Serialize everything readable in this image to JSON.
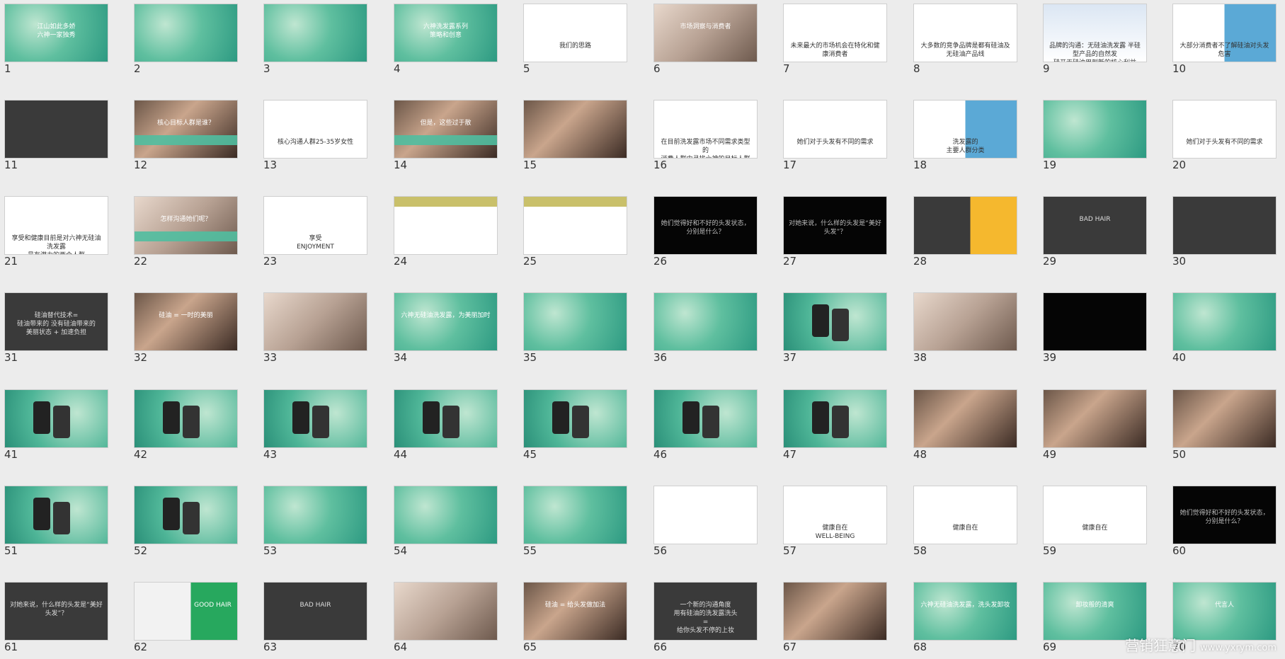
{
  "slides": [
    {
      "n": "1",
      "style": "t-green",
      "title": "江山如此多娇\n六神一家独秀"
    },
    {
      "n": "2",
      "style": "t-green",
      "title": ""
    },
    {
      "n": "3",
      "style": "t-green",
      "title": ""
    },
    {
      "n": "4",
      "style": "t-green",
      "title": "六神洗发露系列\n策略和创意"
    },
    {
      "n": "5",
      "style": "t-white",
      "title": "我们的思路"
    },
    {
      "n": "6",
      "style": "t-photo-light",
      "title": "市场洞察与消费者"
    },
    {
      "n": "7",
      "style": "t-white",
      "title": "未来最大的市场机会在特化和健康消费者"
    },
    {
      "n": "8",
      "style": "t-white",
      "title": "大多数的竞争品牌是都有硅油及无硅油产品线"
    },
    {
      "n": "9",
      "style": "t-blue",
      "title": "品牌的沟通：无硅油洗发露 半硅型产品的自然发\n硅开无硅油用到新的核心利益"
    },
    {
      "n": "10",
      "style": "t-mixed",
      "title": "大部分消费者不了解硅油对头发危害"
    },
    {
      "n": "11",
      "style": "t-dark",
      "title": ""
    },
    {
      "n": "12",
      "style": "t-photo t-bottom-band",
      "title": "核心目标人群是谁？"
    },
    {
      "n": "13",
      "style": "t-white",
      "title": "核心沟通人群25-35岁女性"
    },
    {
      "n": "14",
      "style": "t-photo t-bottom-band",
      "title": "但是，这些过于散"
    },
    {
      "n": "15",
      "style": "t-photo",
      "title": ""
    },
    {
      "n": "16",
      "style": "t-white",
      "title": "在目前洗发露市场不同需求类型的\n消费人群中寻找六神的目标人群"
    },
    {
      "n": "17",
      "style": "t-white",
      "title": "她们对于头发有不同的需求"
    },
    {
      "n": "18",
      "style": "t-mixed",
      "title": "洗发露的\n主要人群分类"
    },
    {
      "n": "19",
      "style": "t-green",
      "title": ""
    },
    {
      "n": "20",
      "style": "t-white",
      "title": "她们对于头发有不同的需求"
    },
    {
      "n": "21",
      "style": "t-white",
      "title": "享受和健康目前是对六神无硅油洗发露\n最有潜力的两个人群"
    },
    {
      "n": "22",
      "style": "t-photo-light t-bottom-band",
      "title": "怎样沟通她们呢？"
    },
    {
      "n": "23",
      "style": "t-white",
      "title": "享受\nENJOYMENT"
    },
    {
      "n": "24",
      "style": "t-yellowband",
      "title": ""
    },
    {
      "n": "25",
      "style": "t-yellowband",
      "title": ""
    },
    {
      "n": "26",
      "style": "t-black",
      "title": "她们觉得好和不好的头发状态，\n分别是什么？"
    },
    {
      "n": "27",
      "style": "t-black",
      "title": "对她来说，什么样的头发是“美好头发”？"
    },
    {
      "n": "28",
      "style": "accent-yellow",
      "title": ""
    },
    {
      "n": "29",
      "style": "t-dark",
      "title": "BAD HAIR"
    },
    {
      "n": "30",
      "style": "t-dark",
      "title": ""
    },
    {
      "n": "31",
      "style": "t-dark",
      "title": "硅油替代技术=\n硅油带来的    没有硅油带来的\n美丽状态   +   加速负担"
    },
    {
      "n": "32",
      "style": "t-photo",
      "title": "硅油 = 一时的美丽"
    },
    {
      "n": "33",
      "style": "t-photo-light",
      "title": ""
    },
    {
      "n": "34",
      "style": "t-green",
      "title": "六神无硅油洗发露，为美丽加时"
    },
    {
      "n": "35",
      "style": "t-green",
      "title": ""
    },
    {
      "n": "36",
      "style": "t-green",
      "title": ""
    },
    {
      "n": "37",
      "style": "t-phone",
      "title": ""
    },
    {
      "n": "38",
      "style": "t-photo-light",
      "title": ""
    },
    {
      "n": "39",
      "style": "t-black",
      "title": ""
    },
    {
      "n": "40",
      "style": "t-green",
      "title": ""
    },
    {
      "n": "41",
      "style": "t-phone",
      "title": ""
    },
    {
      "n": "42",
      "style": "t-phone",
      "title": ""
    },
    {
      "n": "43",
      "style": "t-phone",
      "title": ""
    },
    {
      "n": "44",
      "style": "t-phone",
      "title": ""
    },
    {
      "n": "45",
      "style": "t-phone",
      "title": ""
    },
    {
      "n": "46",
      "style": "t-phone",
      "title": ""
    },
    {
      "n": "47",
      "style": "t-phone",
      "title": ""
    },
    {
      "n": "48",
      "style": "t-photo",
      "title": ""
    },
    {
      "n": "49",
      "style": "t-photo",
      "title": ""
    },
    {
      "n": "50",
      "style": "t-photo",
      "title": ""
    },
    {
      "n": "51",
      "style": "t-phone",
      "title": ""
    },
    {
      "n": "52",
      "style": "t-phone",
      "title": ""
    },
    {
      "n": "53",
      "style": "t-green",
      "title": ""
    },
    {
      "n": "54",
      "style": "t-green",
      "title": ""
    },
    {
      "n": "55",
      "style": "t-green",
      "title": ""
    },
    {
      "n": "56",
      "style": "t-white",
      "title": ""
    },
    {
      "n": "57",
      "style": "t-white",
      "title": "健康自在\nWELL-BEING"
    },
    {
      "n": "58",
      "style": "t-white",
      "title": "健康自在"
    },
    {
      "n": "59",
      "style": "t-white",
      "title": "健康自在"
    },
    {
      "n": "60",
      "style": "t-black",
      "title": "她们觉得好和不好的头发状态，\n分别是什么？"
    },
    {
      "n": "61",
      "style": "t-dark",
      "title": "对她来说，什么样的头发是“美好头发”？"
    },
    {
      "n": "62",
      "style": "green-right",
      "title": "GOOD HAIR"
    },
    {
      "n": "63",
      "style": "t-dark",
      "title": "BAD HAIR"
    },
    {
      "n": "64",
      "style": "t-photo-light",
      "title": ""
    },
    {
      "n": "65",
      "style": "t-photo",
      "title": "硅油 = 给头发做加法"
    },
    {
      "n": "66",
      "style": "t-dark",
      "title": "一个新的沟通角度\n用有硅油的洗发露洗头\n=\n给你头发不停的上妆"
    },
    {
      "n": "67",
      "style": "t-photo",
      "title": ""
    },
    {
      "n": "68",
      "style": "t-green",
      "title": "六神无硅油洗发露，洗头发卸妆"
    },
    {
      "n": "69",
      "style": "t-green",
      "title": "卸妆般的清爽"
    },
    {
      "n": "70",
      "style": "t-green",
      "title": "代言人"
    }
  ],
  "watermark": {
    "text": "营销狂意门",
    "url": "www.yxrym.com"
  }
}
